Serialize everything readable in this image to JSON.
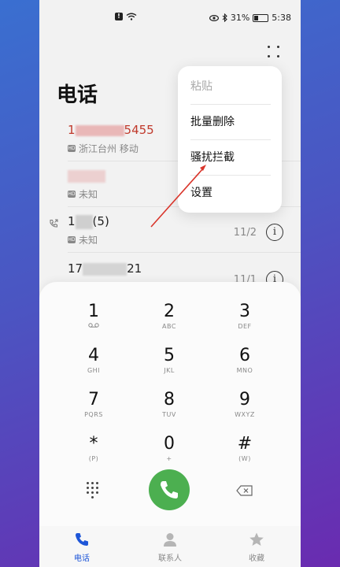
{
  "status_bar": {
    "battery": "31%",
    "battery_level": 0.31,
    "time": "5:38",
    "alert": "!"
  },
  "page": {
    "title": "电话"
  },
  "calls": [
    {
      "number_prefix": "1",
      "number_suffix": "5455",
      "location": "浙江台州 移动",
      "date": "",
      "missed": true
    },
    {
      "number_prefix": "",
      "number_suffix": "",
      "location": "未知",
      "date": "",
      "missed": false
    },
    {
      "number_prefix": "1",
      "number_suffix": "(5)",
      "location": "未知",
      "date": "11/2",
      "missed": false
    },
    {
      "number_prefix": "17",
      "number_suffix": "21",
      "location": "",
      "date": "11/1",
      "missed": false
    }
  ],
  "menu": {
    "items": [
      {
        "label": "粘贴",
        "disabled": true
      },
      {
        "label": "批量删除",
        "disabled": false
      },
      {
        "label": "骚扰拦截",
        "disabled": false
      },
      {
        "label": "设置",
        "disabled": false
      }
    ]
  },
  "dialpad": {
    "keys": [
      {
        "digit": "1",
        "letters": ""
      },
      {
        "digit": "2",
        "letters": "ABC"
      },
      {
        "digit": "3",
        "letters": "DEF"
      },
      {
        "digit": "4",
        "letters": "GHI"
      },
      {
        "digit": "5",
        "letters": "JKL"
      },
      {
        "digit": "6",
        "letters": "MNO"
      },
      {
        "digit": "7",
        "letters": "PQRS"
      },
      {
        "digit": "8",
        "letters": "TUV"
      },
      {
        "digit": "9",
        "letters": "WXYZ"
      },
      {
        "digit": "*",
        "letters": "(P)"
      },
      {
        "digit": "0",
        "letters": "+"
      },
      {
        "digit": "#",
        "letters": "(W)"
      }
    ]
  },
  "bottom_nav": {
    "items": [
      {
        "label": "电话",
        "icon": "phone-icon",
        "active": true
      },
      {
        "label": "联系人",
        "icon": "contact-icon",
        "active": false
      },
      {
        "label": "收藏",
        "icon": "star-icon",
        "active": false
      }
    ]
  },
  "colors": {
    "accent": "#1e56d8",
    "call_green": "#4caf50",
    "missed_red": "#c0392b",
    "annotation_red": "#d9352b"
  }
}
